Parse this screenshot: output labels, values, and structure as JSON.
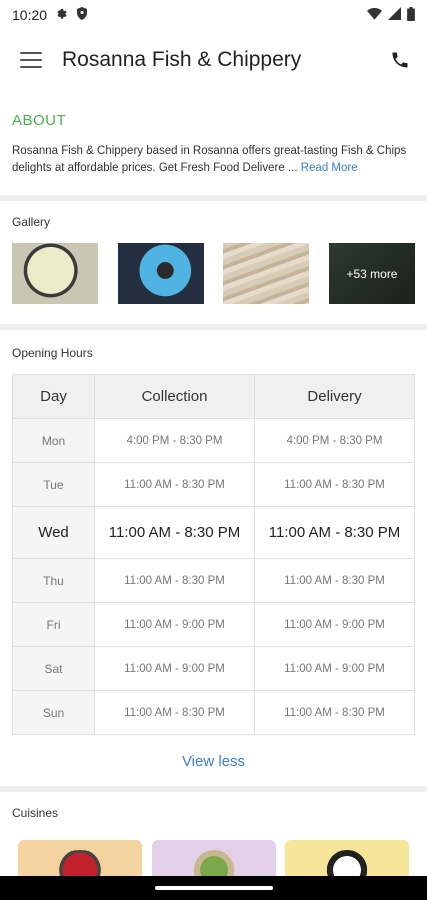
{
  "status_bar": {
    "time": "10:20",
    "icons_left": [
      "gear-icon",
      "shield-icon"
    ],
    "icons_right": [
      "wifi-icon",
      "signal-icon",
      "battery-icon"
    ]
  },
  "app_bar": {
    "title": "Rosanna Fish & Chippery",
    "menu_icon": "hamburger-menu-icon",
    "action_icon": "phone-icon"
  },
  "about": {
    "heading": "ABOUT",
    "text": "Rosanna Fish & Chippery based in Rosanna offers great-tasting Fish & Chips delights at affordable prices. Get Fresh Food Delivere ... ",
    "read_more": "Read More"
  },
  "gallery": {
    "label": "Gallery",
    "more_label": "+53 more"
  },
  "opening_hours": {
    "label": "Opening Hours",
    "headers": [
      "Day",
      "Collection",
      "Delivery"
    ],
    "rows": [
      {
        "day": "Mon",
        "collection": "4:00 PM - 8:30 PM",
        "delivery": "4:00 PM - 8:30 PM"
      },
      {
        "day": "Tue",
        "collection": "11:00 AM - 8:30 PM",
        "delivery": "11:00 AM - 8:30 PM"
      },
      {
        "day": "Wed",
        "collection": "11:00 AM - 8:30 PM",
        "delivery": "11:00 AM - 8:30 PM"
      },
      {
        "day": "Thu",
        "collection": "11:00 AM - 8:30 PM",
        "delivery": "11:00 AM - 8:30 PM"
      },
      {
        "day": "Fri",
        "collection": "11:00 AM - 9:00 PM",
        "delivery": "11:00 AM - 9:00 PM"
      },
      {
        "day": "Sat",
        "collection": "11:00 AM - 9:00 PM",
        "delivery": "11:00 AM - 9:00 PM"
      },
      {
        "day": "Sun",
        "collection": "11:00 AM - 8:30 PM",
        "delivery": "11:00 AM - 8:30 PM"
      }
    ],
    "today": "Wed",
    "view_less": "View less"
  },
  "cuisines": {
    "label": "Cuisines"
  },
  "colors": {
    "accent_green": "#4caf50",
    "link_blue": "#3b7dd8"
  }
}
